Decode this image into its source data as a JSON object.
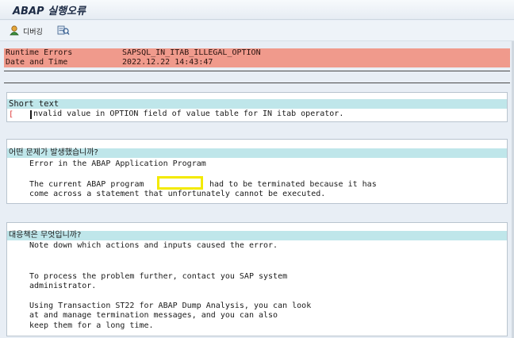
{
  "window": {
    "title": "ABAP 실행오류"
  },
  "toolbar": {
    "debug_label": "디버깅"
  },
  "header": {
    "rows": [
      {
        "key": "Runtime Errors",
        "value": "SAPSQL_IN_ITAB_ILLEGAL_OPTION"
      },
      {
        "key": "Date and Time",
        "value": "2022.12.22 14:43:47"
      }
    ]
  },
  "short_text": {
    "heading": "Short text",
    "marker": "[",
    "line": "nvalid value in OPTION field of value table for IN itab operator."
  },
  "what_happened": {
    "heading": "어떤 문제가 발생했습니까?",
    "line1": "Error in the ABAP Application Program",
    "line2_a": "The current ABAP program",
    "line2_b": "had to be terminated because it has",
    "line3": "come across a statement that unfortunately cannot be executed."
  },
  "what_can_you_do": {
    "heading": "대응책은 무엇입니까?",
    "line1": "Note down which actions and inputs caused the error.",
    "line2": "To process the problem further, contact you SAP system",
    "line3": "administrator.",
    "line4": "Using Transaction ST22 for ABAP Dump Analysis, you can look",
    "line5": "at and manage termination messages, and you can also",
    "line6": "keep them for a long time."
  },
  "colors": {
    "header_band": "#f09a8c",
    "section_heading": "#bfe6ea",
    "redaction_box": "#f3ea00"
  }
}
